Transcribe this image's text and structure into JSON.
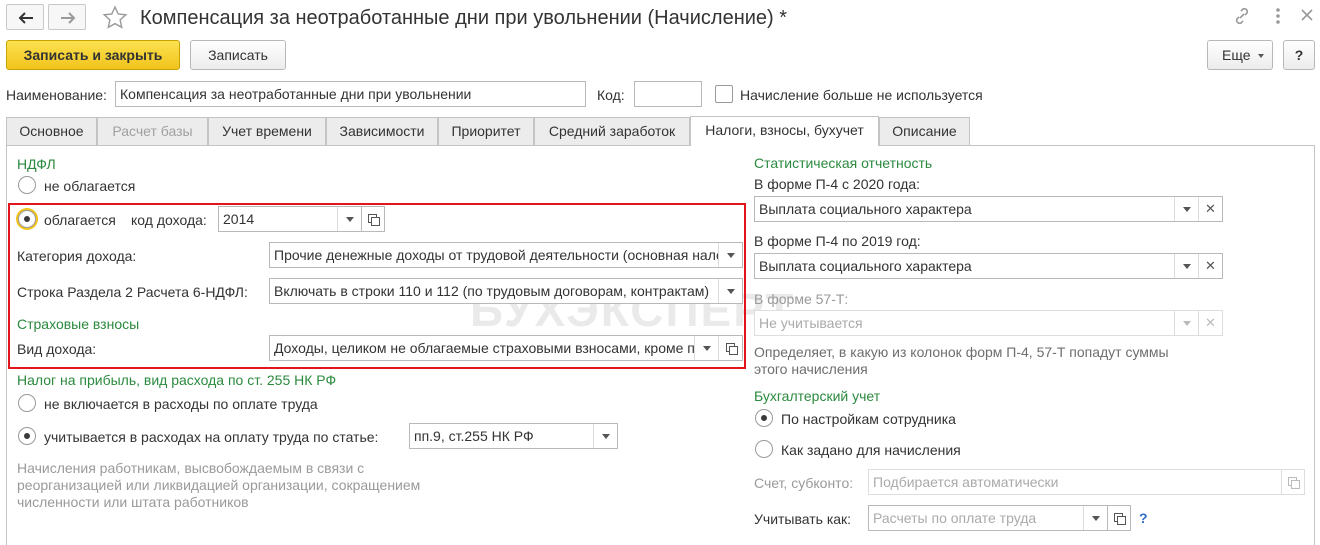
{
  "window": {
    "title": "Компенсация за неотработанные дни при увольнении (Начисление) *"
  },
  "toolbar": {
    "save_close": "Записать и закрыть",
    "save": "Записать",
    "more": "Еще",
    "help": "?"
  },
  "header": {
    "name_label": "Наименование:",
    "name_value": "Компенсация за неотработанные дни при увольнении",
    "code_label": "Код:",
    "code_value": "",
    "unused_label": "Начисление больше не используется"
  },
  "tabs": [
    {
      "label": "Основное"
    },
    {
      "label": "Расчет базы"
    },
    {
      "label": "Учет времени"
    },
    {
      "label": "Зависимости"
    },
    {
      "label": "Приоритет"
    },
    {
      "label": "Средний заработок"
    },
    {
      "label": "Налоги, взносы, бухучет"
    },
    {
      "label": "Описание"
    }
  ],
  "ndfl": {
    "section": "НДФЛ",
    "not_taxed": "не облагается",
    "taxed": "облагается",
    "income_code_label": "код дохода:",
    "income_code_value": "2014",
    "category_label": "Категория дохода:",
    "category_value": "Прочие денежные доходы от трудовой деятельности (основная налоговая база)",
    "row_label": "Строка Раздела 2 Расчета 6-НДФЛ:",
    "row_value": "Включать в строки 110 и 112 (по трудовым договорам, контрактам)"
  },
  "insurance": {
    "section": "Страховые взносы",
    "income_type_label": "Вид дохода:",
    "income_type_value": "Доходы, целиком не облагаемые страховыми взносами, кроме пособий"
  },
  "profit_tax": {
    "section": "Налог на прибыль, вид расхода по ст. 255 НК РФ",
    "not_included": "не включается в расходы по оплате труда",
    "included": "учитывается в расходах на оплату труда по статье:",
    "article_value": "пп.9, ст.255 НК РФ",
    "note_line1": "Начисления работникам, высвобождаемым в связи с",
    "note_line2": "реорганизацией или ликвидацией организации, сокращением",
    "note_line3": "численности или штата работников"
  },
  "stats": {
    "section": "Статистическая отчетность",
    "p4_2020_label": "В форме П-4 с 2020 года:",
    "p4_2020_value": "Выплата социального характера",
    "p4_2019_label": "В форме П-4 по 2019 год:",
    "p4_2019_value": "Выплата социального характера",
    "f57_label": "В форме 57-Т:",
    "f57_value": "Не учитывается",
    "note_line1": "Определяет, в какую из колонок форм П-4, 57-Т попадут суммы",
    "note_line2": "этого начисления"
  },
  "accounting": {
    "section": "Бухгалтерский учет",
    "by_employee": "По настройкам сотрудника",
    "as_defined": "Как задано для начисления",
    "account_label": "Счет, субконто:",
    "account_placeholder": "Подбирается автоматически",
    "account_as_label": "Учитывать как:",
    "account_as_placeholder": "Расчеты по оплате труда",
    "help": "?"
  },
  "watermark": "БУХЭКСПЕРТ",
  "colors": {
    "accent": "#f2c31c",
    "section_green": "#2b8a3e",
    "highlight_red": "#e2141c"
  }
}
